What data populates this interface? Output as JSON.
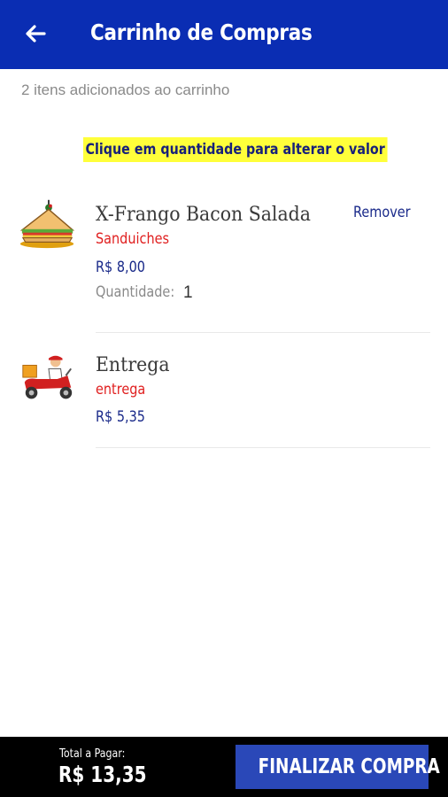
{
  "appbar": {
    "back_icon": "arrow-left-icon",
    "title": "Carrinho de Compras",
    "color": "#0a2db3"
  },
  "cart": {
    "items_count_text": "2 itens adicionados ao carrinho",
    "hint_text": "Clique em quantidade para alterar o valor",
    "hint_bg": "#ffff3a"
  },
  "items": [
    {
      "icon": "sandwich-icon",
      "name": "X-Frango Bacon Salada",
      "category": "Sanduiches",
      "price": "R$ 8,00",
      "quantity_label": "Quantidade:",
      "quantity": "1",
      "remove_label": "Remover"
    },
    {
      "icon": "delivery-scooter-icon",
      "name": "Entrega",
      "category": "entrega",
      "price": "R$ 5,35"
    }
  ],
  "footer": {
    "total_label": "Total a Pagar:",
    "total_value": "R$ 13,35",
    "finish_label": "FINALIZAR COMPRA"
  }
}
